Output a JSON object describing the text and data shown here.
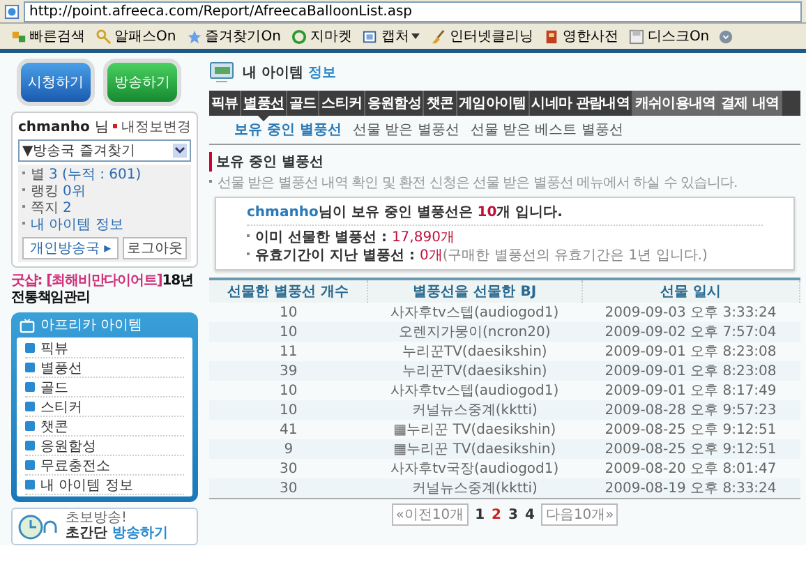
{
  "browser": {
    "url": "http://point.afreeca.com/Report/AfreecaBalloonList.asp",
    "toolbar": [
      {
        "label": "빠른검색",
        "dropdown": false
      },
      {
        "label": "알패스On",
        "dropdown": false
      },
      {
        "label": "즐겨찾기On",
        "dropdown": false
      },
      {
        "label": "지마켓",
        "dropdown": false
      },
      {
        "label": "캡처",
        "dropdown": true
      },
      {
        "label": "인터넷클리닝",
        "dropdown": false
      },
      {
        "label": "영한사전",
        "dropdown": false
      },
      {
        "label": "디스크On",
        "dropdown": false
      }
    ]
  },
  "left": {
    "buttons": [
      {
        "label": "시청하기",
        "kind": "watch"
      },
      {
        "label": "방송하기",
        "kind": "broadcast"
      }
    ],
    "user": {
      "name": "chmanho",
      "suffix": "님",
      "edit_link": "내정보변경",
      "select": "▼방송국 즐겨찾기",
      "stats": [
        {
          "label": "별",
          "value": "3 (누적 : 601)"
        },
        {
          "label": "랭킹",
          "value": "0위"
        },
        {
          "label": "쪽지",
          "value": "2"
        },
        {
          "value": "내 아이템 정보"
        }
      ],
      "buttons": [
        "개인방송국 ▸",
        "로그아웃"
      ]
    },
    "promo": {
      "label": "굿샵:",
      "tag": "[최해비만다이어트]",
      "text": "18년전통책임관리"
    },
    "items_panel": {
      "title": "아프리카 아이템",
      "items": [
        "픽뷰",
        "별풍선",
        "골드",
        "스티커",
        "챗콘",
        "응원함성",
        "무료충전소",
        "내 아이템 정보"
      ]
    },
    "quick": {
      "small": "초보방송!",
      "text": "초간단 ",
      "link": "방송하기"
    }
  },
  "main": {
    "title": "내 아이템",
    "title_accent": "정보",
    "tabs": [
      {
        "label": "픽뷰",
        "selected": false,
        "kind": "main"
      },
      {
        "label": "별풍선",
        "selected": true,
        "kind": "main"
      },
      {
        "label": "골드",
        "selected": false,
        "kind": "main"
      },
      {
        "label": "스티커",
        "selected": false,
        "kind": "main"
      },
      {
        "label": "응원함성",
        "selected": false,
        "kind": "main"
      },
      {
        "label": "챗콘",
        "selected": false,
        "kind": "main"
      },
      {
        "label": "게임아이템",
        "selected": false,
        "kind": "main"
      },
      {
        "label": "시네마 관람내역",
        "selected": false,
        "kind": "main"
      },
      {
        "label": "캐쉬이용내역",
        "selected": false,
        "kind": "extra"
      },
      {
        "label": "결제 내역",
        "selected": false,
        "kind": "extra"
      }
    ],
    "subtabs": [
      {
        "label": "보유 중인 별풍선",
        "selected": true
      },
      {
        "label": "선물 받은 별풍선",
        "selected": false
      },
      {
        "label": "선물 받은 베스트 별풍선",
        "selected": false
      }
    ],
    "section": {
      "title": "보유 중인 별풍선",
      "note": "선물 받은 별풍선 내역 확인 및 환전 신청은 선물 받은 별풍선 메뉴에서 하실 수 있습니다."
    },
    "summary": {
      "user": "chmanho",
      "text1": "님이 보유 중인 별풍선은 ",
      "count": "10",
      "text2": "개 입니다.",
      "lines": [
        {
          "label": "이미 선물한 별풍선 : ",
          "value": "17,890개"
        },
        {
          "label": "유효기간이 지난 별풍선 : ",
          "value": "0개",
          "note": "(구매한 별풍선의 유효기간은 1년 입니다.)"
        }
      ]
    },
    "table": {
      "columns": [
        "선물한 별풍선 개수",
        "별풍선을 선물한 BJ",
        "선물 일시"
      ],
      "rows": [
        [
          "10",
          "사자후tv스텝(audiogod1)",
          "2009-09-03 오후 3:33:24"
        ],
        [
          "10",
          "오렌지가뭉이(ncron20)",
          "2009-09-02 오후 7:57:04"
        ],
        [
          "11",
          "누리꾼TV(daesikshin)",
          "2009-09-01 오후 8:23:08"
        ],
        [
          "39",
          "누리꾼TV(daesikshin)",
          "2009-09-01 오후 8:23:08"
        ],
        [
          "10",
          "사자후tv스텝(audiogod1)",
          "2009-09-01 오후 8:17:49"
        ],
        [
          "10",
          "커널뉴스중계(kktti)",
          "2009-08-28 오후 9:57:23"
        ],
        [
          "41",
          "▦누리꾼 TV(daesikshin)",
          "2009-08-25 오후 9:12:51"
        ],
        [
          "9",
          "▦누리꾼 TV(daesikshin)",
          "2009-08-25 오후 9:12:51"
        ],
        [
          "30",
          "사자후tv국장(audiogod1)",
          "2009-08-20 오후 8:01:47"
        ],
        [
          "30",
          "커널뉴스중계(kktti)",
          "2009-08-19 오후 8:33:24"
        ]
      ]
    },
    "pagination": {
      "prev": "«이전10개",
      "pages": [
        {
          "label": "1",
          "selected": false
        },
        {
          "label": "2",
          "selected": true
        },
        {
          "label": "3",
          "selected": false
        },
        {
          "label": "4",
          "selected": false
        }
      ],
      "next": "다음10개»"
    }
  }
}
